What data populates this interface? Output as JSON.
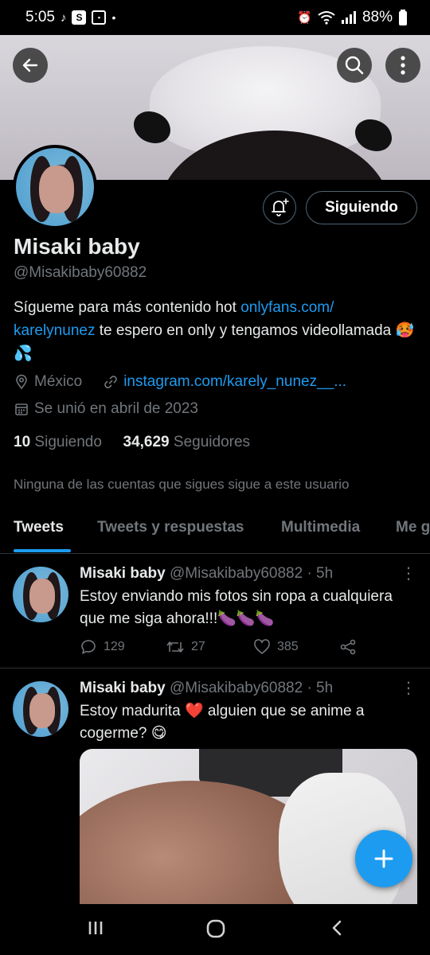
{
  "status_bar": {
    "time": "5:05",
    "battery": "88%",
    "icons": [
      "tiktok-icon",
      "s-icon",
      "message-icon",
      "dot-icon",
      "alarm-icon",
      "wifi-icon",
      "signal-icon",
      "battery-icon"
    ]
  },
  "header": {
    "back_icon": "back-arrow-icon",
    "search_icon": "search-icon",
    "more_icon": "more-vertical-icon"
  },
  "profile": {
    "name": "Misaki baby",
    "handle": "@Misakibaby60882",
    "bio_text_1": "Sígueme para más contenido hot ",
    "bio_link_1": "onlyfans.com/",
    "bio_link_2": "karelynunez",
    "bio_text_2": " te espero en only y  tengamos videollamada 🥵💦",
    "location": "México",
    "website": "instagram.com/karely_nunez__...",
    "joined": "Se unió en abril de 2023",
    "following_count": "10",
    "following_label": "Siguiendo",
    "followers_count": "34,629",
    "followers_label": "Seguidores",
    "not_followed_notice": "Ninguna de las cuentas que sigues sigue a este usuario",
    "follow_button": "Siguiendo",
    "accent_color": "#1d9bf0"
  },
  "tabs": [
    {
      "label": "Tweets",
      "active": true
    },
    {
      "label": "Tweets y respuestas",
      "active": false
    },
    {
      "label": "Multimedia",
      "active": false
    },
    {
      "label": "Me g",
      "active": false
    }
  ],
  "tweets": [
    {
      "name": "Misaki baby",
      "handle": "@Misakibaby60882",
      "time": "· 5h",
      "text": "Estoy enviando mis fotos sin ropa a cualquiera que me siga ahora!!!🍆🍆🍆",
      "replies": "129",
      "retweets": "27",
      "likes": "385"
    },
    {
      "name": "Misaki baby",
      "handle": "@Misakibaby60882",
      "time": "· 5h",
      "text": "Estoy madurita ❤️ alguien que se anime a cogerme? 😋"
    }
  ],
  "fab": {
    "icon": "compose-plus-icon",
    "label": "+"
  },
  "nav": {
    "recents": "|||",
    "home": "○",
    "back": "‹"
  }
}
